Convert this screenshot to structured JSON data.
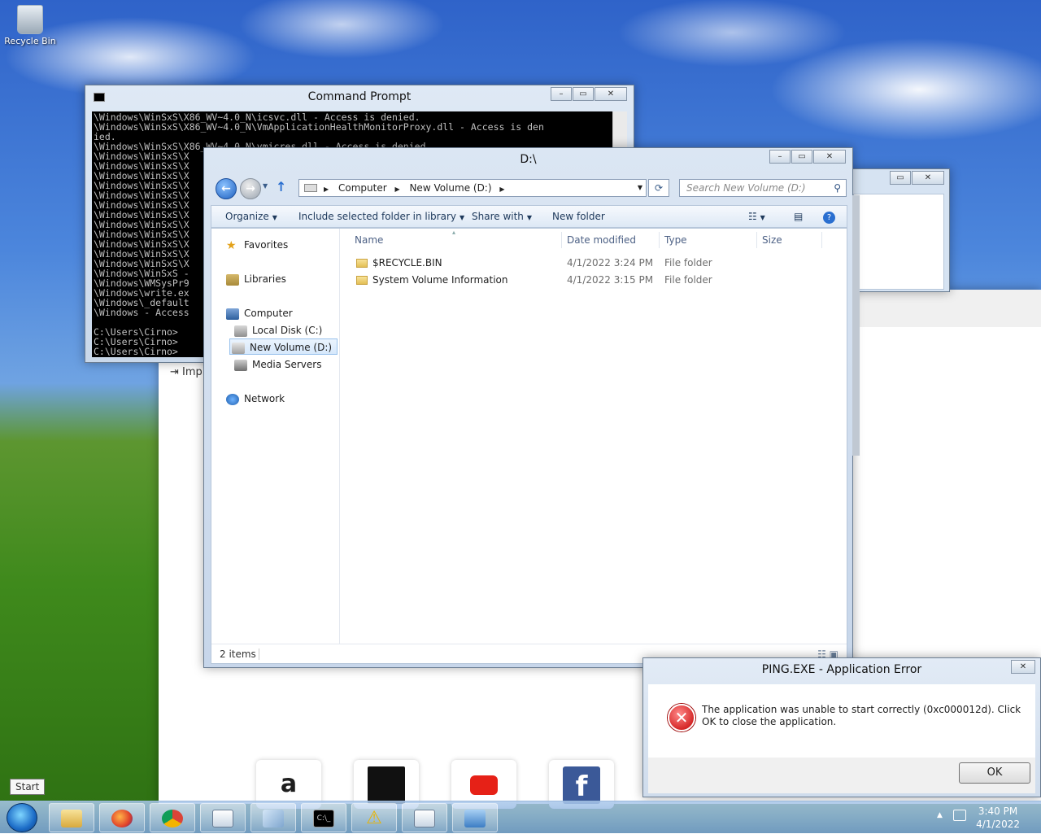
{
  "desktop": {
    "recycle_bin_label": "Recycle Bin"
  },
  "cmd": {
    "title": "Command Prompt",
    "lines": [
      "\\Windows\\WinSxS\\X86_WV~4.0_N\\icsvc.dll - Access is denied.",
      "\\Windows\\WinSxS\\X86_WV~4.0_N\\VmApplicationHealthMonitorProxy.dll - Access is den",
      "ied.",
      "\\Windows\\WinSxS\\X86_WV~4.0_N\\vmicres.dll - Access is denied.",
      "\\Windows\\WinSxS\\X",
      "\\Windows\\WinSxS\\X",
      "\\Windows\\WinSxS\\X",
      "\\Windows\\WinSxS\\X",
      "\\Windows\\WinSxS\\X",
      "\\Windows\\WinSxS\\X",
      "\\Windows\\WinSxS\\X",
      "\\Windows\\WinSxS\\X",
      "\\Windows\\WinSxS\\X",
      "\\Windows\\WinSxS\\X",
      "\\Windows\\WinSxS\\X",
      "\\Windows\\WinSxS\\X",
      "\\Windows\\WinSxS -",
      "\\Windows\\WMSysPr9",
      "\\Windows\\write.ex",
      "\\Windows\\_default",
      "\\Windows - Access",
      "",
      "C:\\Users\\Cirno>",
      "C:\\Users\\Cirno>",
      "C:\\Users\\Cirno>"
    ]
  },
  "explorer": {
    "title": "D:\\",
    "address": {
      "segments": [
        "Computer",
        "New Volume (D:)"
      ]
    },
    "search_placeholder": "Search New Volume (D:)",
    "toolbar": {
      "organize": "Organize",
      "include_library": "Include selected folder in library",
      "share_with": "Share with",
      "new_folder": "New folder"
    },
    "nav": {
      "favorites": "Favorites",
      "libraries": "Libraries",
      "computer": "Computer",
      "local_disk": "Local Disk (C:)",
      "new_volume": "New Volume (D:)",
      "media_servers": "Media Servers",
      "network": "Network"
    },
    "columns": {
      "name": "Name",
      "date_modified": "Date modified",
      "type": "Type",
      "size": "Size"
    },
    "files": [
      {
        "name": "$RECYCLE.BIN",
        "date": "4/1/2022 3:24 PM",
        "type": "File folder"
      },
      {
        "name": "System Volume Information",
        "date": "4/1/2022 3:15 PM",
        "type": "File folder"
      }
    ],
    "status": "2 items"
  },
  "background_window": {
    "import_label": "Imp"
  },
  "error_dialog": {
    "title": "PING.EXE - Application Error",
    "message": "The application was unable to start correctly (0xc000012d). Click OK to close the application.",
    "ok_label": "OK"
  },
  "taskbar": {
    "start_tooltip": "Start",
    "clock_time": "3:40 PM",
    "clock_date": "4/1/2022",
    "buttons": [
      "explorer",
      "firefox",
      "chrome",
      "notepad",
      "paint",
      "cmd",
      "warning",
      "notepad",
      "control-panel"
    ]
  },
  "colors": {
    "accent": "#1d5fbf",
    "error": "#c40000"
  }
}
